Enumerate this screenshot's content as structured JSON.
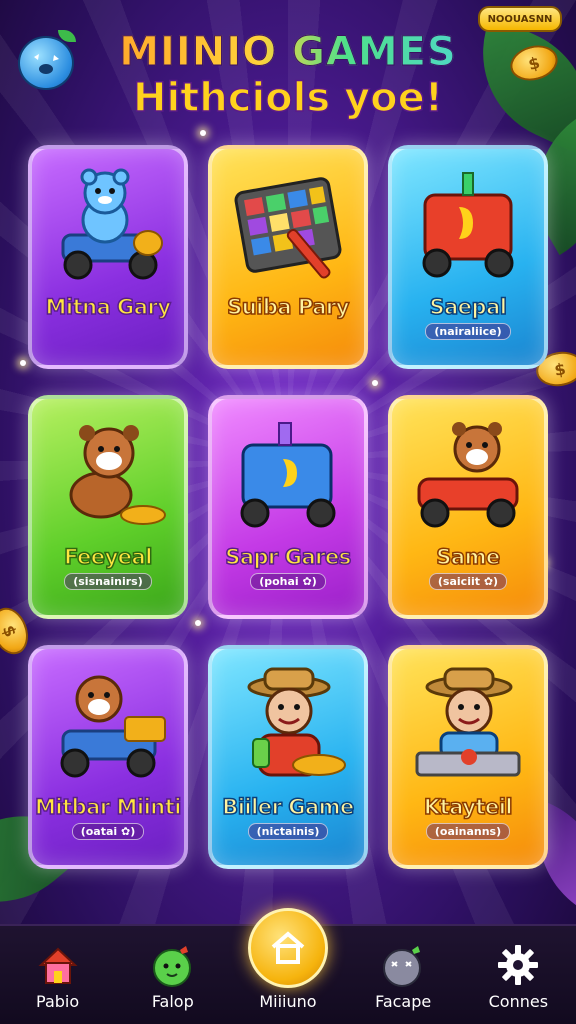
{
  "header": {
    "title_line1": "MIINIO GAMES",
    "title_line2": "Hithciols yoe!",
    "badge": "NOOUASNN"
  },
  "coins": {
    "symbol": "$"
  },
  "games": [
    {
      "name": "Mitna Gary",
      "subtitle": "",
      "color": "purple",
      "art": "bear-kart-icon"
    },
    {
      "name": "Suiba Pary",
      "subtitle": "",
      "color": "yellow",
      "art": "puzzle-board-icon"
    },
    {
      "name": "Saepal",
      "subtitle": "(nairaliice)",
      "color": "blue",
      "art": "robot-cart-icon"
    },
    {
      "name": "Feeyeal",
      "subtitle": "(sisnainirs)",
      "color": "green",
      "art": "puppy-icon"
    },
    {
      "name": "Sapr Gares",
      "subtitle": "(pohai ✿)",
      "color": "magenta",
      "art": "blue-cart-icon"
    },
    {
      "name": "Same",
      "subtitle": "(saiciit ✿)",
      "color": "yellow",
      "art": "bear-car-icon"
    },
    {
      "name": "Mitbar Miinti",
      "subtitle": "(oatai ✿)",
      "color": "purple",
      "art": "squirrel-kart-icon"
    },
    {
      "name": "Biiler Game",
      "subtitle": "(nictainis)",
      "color": "blue",
      "art": "cook-icon"
    },
    {
      "name": "Ktayteil",
      "subtitle": "(oainanns)",
      "color": "yellow",
      "art": "chef-icon"
    }
  ],
  "nav": [
    {
      "label": "Pabio",
      "icon": "home-icon"
    },
    {
      "label": "Falop",
      "icon": "pea-icon"
    },
    {
      "label": "Miiiuno",
      "icon": "center-home-icon",
      "active": true
    },
    {
      "label": "Facape",
      "icon": "ball-icon"
    },
    {
      "label": "Connes",
      "icon": "gear-icon"
    }
  ]
}
